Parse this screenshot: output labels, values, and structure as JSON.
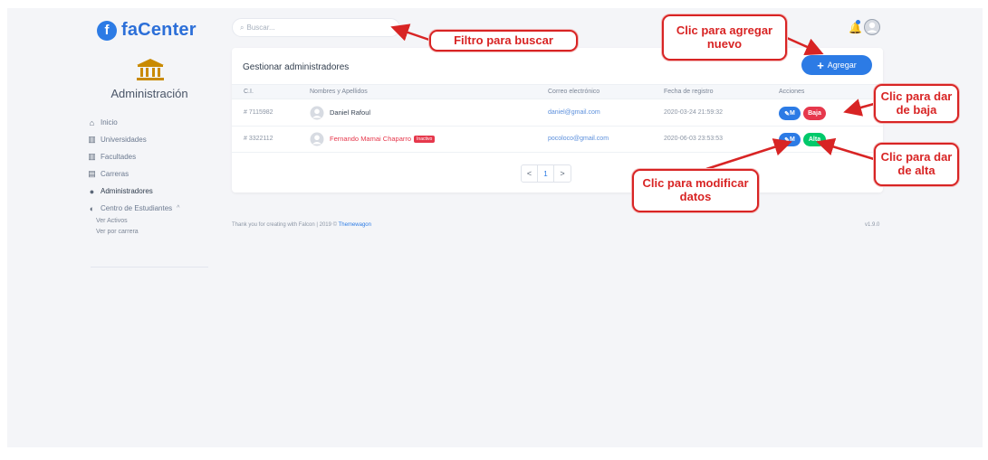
{
  "brand": {
    "logo_letter": "f",
    "name": "faCenter"
  },
  "sidebar": {
    "section_title": "Administración",
    "items": [
      {
        "icon": "home-icon",
        "glyph": "⌂",
        "label": "Inicio"
      },
      {
        "icon": "university-icon",
        "glyph": "▥",
        "label": "Universidades"
      },
      {
        "icon": "faculty-icon",
        "glyph": "▥",
        "label": "Facultades"
      },
      {
        "icon": "career-icon",
        "glyph": "▤",
        "label": "Carreras"
      },
      {
        "icon": "users-icon",
        "glyph": "●",
        "label": "Administradores"
      },
      {
        "icon": "student-center-icon",
        "glyph": "◐",
        "label": "Centro de Estudiantes",
        "chevron": "^"
      }
    ],
    "subitems": [
      "Ver Activos",
      "Ver por carrera"
    ]
  },
  "search": {
    "icon": "search-icon",
    "glyph": "⌕",
    "placeholder": "Buscar..."
  },
  "card": {
    "title": "Gestionar administradores",
    "add_button": {
      "plus": "+",
      "label": "Agregar"
    },
    "columns": [
      "C.I.",
      "Nombres y Apellidos",
      "Correo electrónico",
      "Fecha de registro",
      "Acciones"
    ],
    "rows": [
      {
        "ci": "# 7115982",
        "name": "Daniel Rafoul",
        "inactive": false,
        "email": "daniel@gmail.com",
        "date": "2020-03-24 21:59:32",
        "modify": "M",
        "status_action": "Baja"
      },
      {
        "ci": "# 3322112",
        "name": "Fernando Mamai Chaparro",
        "inactive": true,
        "badge": "Inactivo",
        "email": "pocoloco@gmail.com",
        "date": "2020-06-03 23:53:53",
        "modify": "M",
        "status_action": "Alta"
      }
    ]
  },
  "pager": {
    "prev": "<",
    "current": "1",
    "next": ">"
  },
  "footer": {
    "text": "Thank you for creating with Falcon | 2019 © ",
    "link": "Themewagon",
    "version": "v1.9.0"
  },
  "callouts": {
    "filtro": "Filtro para buscar",
    "agregar": "Clic para agregar nuevo",
    "baja": "Clic para dar de baja",
    "alta": "Clic para dar de alta",
    "modificar": "Clic para modificar datos"
  },
  "colors": {
    "primary": "#2c7be5",
    "danger": "#e6384c",
    "success": "#00c96a",
    "callout": "#d82424"
  }
}
